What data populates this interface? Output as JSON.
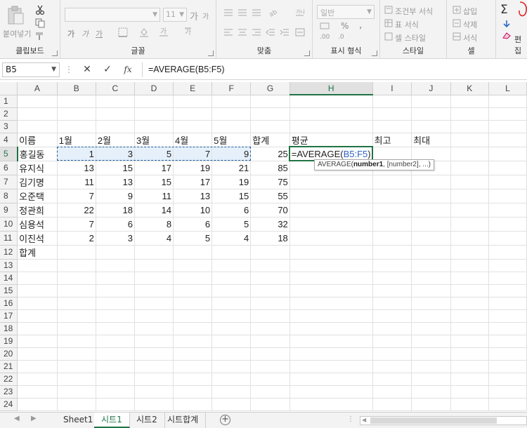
{
  "ribbon": {
    "clipboard": {
      "paste_label": "붙여넣기",
      "group_label": "클립보드"
    },
    "font": {
      "size_value": "11",
      "bold": "가",
      "italic": "가",
      "underline": "가",
      "grow": "가",
      "shrink": "가",
      "group_label": "글꼴"
    },
    "alignment": {
      "group_label": "맞춤"
    },
    "number": {
      "format_value": "일반",
      "percent": "%",
      "group_label": "표시 형식"
    },
    "styles": {
      "conditional": "조건부 서식",
      "table": "표 서식",
      "cell": "셀 스타일",
      "group_label": "스타일"
    },
    "cells": {
      "insert": "삽입",
      "delete": "삭제",
      "format": "서식",
      "group_label": "셀"
    },
    "editing": {
      "sum": "Σ",
      "group_label": "편집"
    }
  },
  "formula_bar": {
    "name_box": "B5",
    "cancel": "✕",
    "enter": "✓",
    "fx": "fx",
    "formula": "=AVERAGE(B5:F5)"
  },
  "columns": [
    "A",
    "B",
    "C",
    "D",
    "E",
    "F",
    "G",
    "H",
    "I",
    "J",
    "K",
    "L"
  ],
  "rows": [
    [
      "",
      "",
      "",
      "",
      "",
      "",
      "",
      "",
      "",
      ""
    ],
    [
      "",
      "",
      "",
      "",
      "",
      "",
      "",
      "",
      "",
      ""
    ],
    [
      "",
      "",
      "",
      "",
      "",
      "",
      "",
      "",
      "",
      ""
    ],
    [
      "이름",
      "1월",
      "2월",
      "3월",
      "4월",
      "5월",
      "합계",
      "평균",
      "최고",
      "최대"
    ],
    [
      "홍길동",
      "1",
      "3",
      "5",
      "7",
      "9",
      "25",
      "",
      "",
      ""
    ],
    [
      "유지식",
      "13",
      "15",
      "17",
      "19",
      "21",
      "85",
      "",
      "",
      ""
    ],
    [
      "김기명",
      "11",
      "13",
      "15",
      "17",
      "19",
      "75",
      "",
      "",
      ""
    ],
    [
      "오준택",
      "7",
      "9",
      "11",
      "13",
      "15",
      "55",
      "",
      "",
      ""
    ],
    [
      "정관희",
      "22",
      "18",
      "14",
      "10",
      "6",
      "70",
      "",
      "",
      ""
    ],
    [
      "심용석",
      "7",
      "6",
      "8",
      "6",
      "5",
      "32",
      "",
      "",
      ""
    ],
    [
      "이진석",
      "2",
      "3",
      "4",
      "5",
      "4",
      "18",
      "",
      "",
      ""
    ],
    [
      "합계",
      "",
      "",
      "",
      "",
      "",
      "",
      "",
      "",
      ""
    ]
  ],
  "row_count": 24,
  "editing_cell": {
    "prefix": "=AVERAGE(",
    "ref": "B5:F5",
    "suffix": ")"
  },
  "tooltip": {
    "fn": "AVERAGE(",
    "arg1": "number1",
    "rest": ", [number2], ...)"
  },
  "sheet_tabs": [
    "Sheet1",
    "시트1",
    "시트2",
    "시트합계"
  ],
  "active_tab": "시트1",
  "colors": {
    "accent": "#217346",
    "ref_blue": "#2f63c5",
    "annotation_red": "#e02020"
  }
}
